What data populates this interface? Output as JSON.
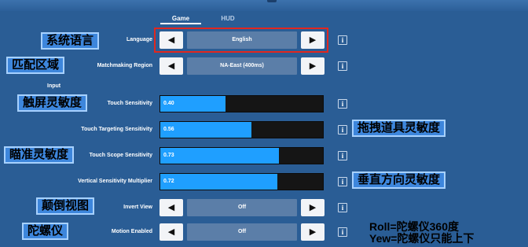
{
  "tabs": [
    {
      "label": "Game"
    },
    {
      "label": "HUD"
    }
  ],
  "section_label": "Input",
  "settings": {
    "language": {
      "label": "Language",
      "value": "English"
    },
    "matchmaking": {
      "label": "Matchmaking Region",
      "value": "NA-East (400ms)"
    },
    "touch_sensitivity": {
      "label": "Touch Sensitivity",
      "value": "0.40",
      "fraction": 0.4
    },
    "touch_targeting": {
      "label": "Touch Targeting Sensitivity",
      "value": "0.56",
      "fraction": 0.56
    },
    "touch_scope": {
      "label": "Touch Scope Sensitivity",
      "value": "0.73",
      "fraction": 0.73
    },
    "vertical_multiplier": {
      "label": "Vertical Sensitivity Multiplier",
      "value": "0.72",
      "fraction": 0.72
    },
    "invert_view": {
      "label": "Invert View",
      "value": "Off"
    },
    "motion_enabled": {
      "label": "Motion Enabled",
      "value": "Off"
    }
  },
  "icons": {
    "prev": "◀",
    "next": "▶",
    "info": "i"
  },
  "annotations": {
    "system_language": "系统语言",
    "matchmaking": "匹配区域",
    "touch_sensitivity": "触屏灵敏度",
    "drag_item": "拖拽道具灵敏度",
    "aim": "瞄准灵敏度",
    "vertical": "垂直方向灵敏度",
    "invert": "颠倒视图",
    "gyro": "陀螺仪"
  },
  "notes": {
    "roll": "Roll=陀螺仪360度",
    "yew": "Yew=陀螺仪只能上下"
  },
  "colors": {
    "background": "#2a5d95",
    "slider_fill": "#1f9fff",
    "slider_track": "#151515",
    "highlight_outline": "#e0271f",
    "annotation_fill": "#3d86dc"
  }
}
